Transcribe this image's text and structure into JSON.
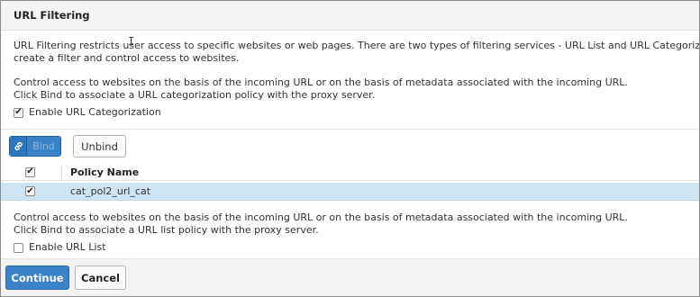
{
  "header": {
    "title": "URL Filtering"
  },
  "intro": {
    "line1": "URL Filtering restricts user access to specific websites or web pages. There are two types of filtering services - URL List and URL Categorization. Select a service to",
    "line2": "create a filter and control access to websites.",
    "categorization_line1": "Control access to websites on the basis of the incoming URL or on the basis of metadata associated with the incoming URL.",
    "categorization_line2": "Click Bind to associate a URL categorization policy with the proxy server.",
    "enable_categorization_label": "Enable URL Categorization",
    "enable_categorization_checked": true
  },
  "toolbar": {
    "bind_label": "Bind",
    "unbind_label": "Unbind",
    "bind_icon": "link-icon"
  },
  "table": {
    "header_checked": true,
    "columns": [
      "Policy Name"
    ],
    "rows": [
      {
        "checked": true,
        "policy_name": "cat_pol2_url_cat",
        "selected": true
      }
    ]
  },
  "url_list": {
    "line1": "Control access to websites on the basis of the incoming URL or on the basis of metadata associated with the incoming URL.",
    "line2": "Click Bind to associate a URL list policy with the proxy server.",
    "enable_list_label": "Enable URL List",
    "enable_list_checked": false
  },
  "footer": {
    "continue_label": "Continue",
    "cancel_label": "Cancel"
  },
  "colors": {
    "accent": "#3a83c8",
    "row_selected": "#cde4f4",
    "header_bg": "#f4f4f4"
  }
}
